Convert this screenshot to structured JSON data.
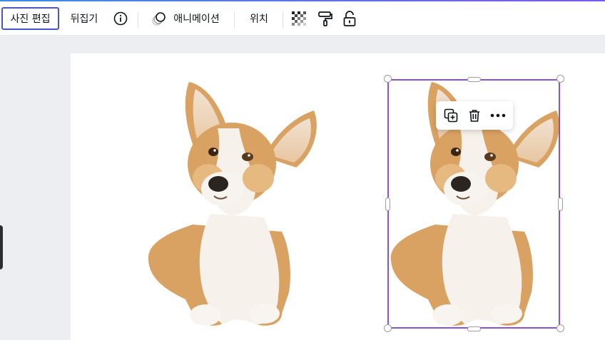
{
  "toolbar": {
    "edit_photo_label": "사진 편집",
    "flip_label": "뒤집기",
    "info_icon": "info-icon",
    "animate_label": "애니메이션",
    "animate_icon": "animate-circles-icon",
    "position_label": "위치",
    "transparency_icon": "transparency-checker-icon",
    "paint_icon": "paint-roller-icon",
    "lock_icon": "lock-icon"
  },
  "context_menu": {
    "duplicate_icon": "duplicate-icon",
    "delete_icon": "trash-icon",
    "more_icon": "more-dots-icon"
  },
  "canvas": {
    "elements": [
      {
        "type": "image",
        "subject": "corgi-dog",
        "selected": false
      },
      {
        "type": "image",
        "subject": "corgi-dog",
        "selected": true
      }
    ]
  },
  "colors": {
    "selection": "#8b4fdb",
    "active_button_border": "#4656c8",
    "background": "#eceef1"
  }
}
